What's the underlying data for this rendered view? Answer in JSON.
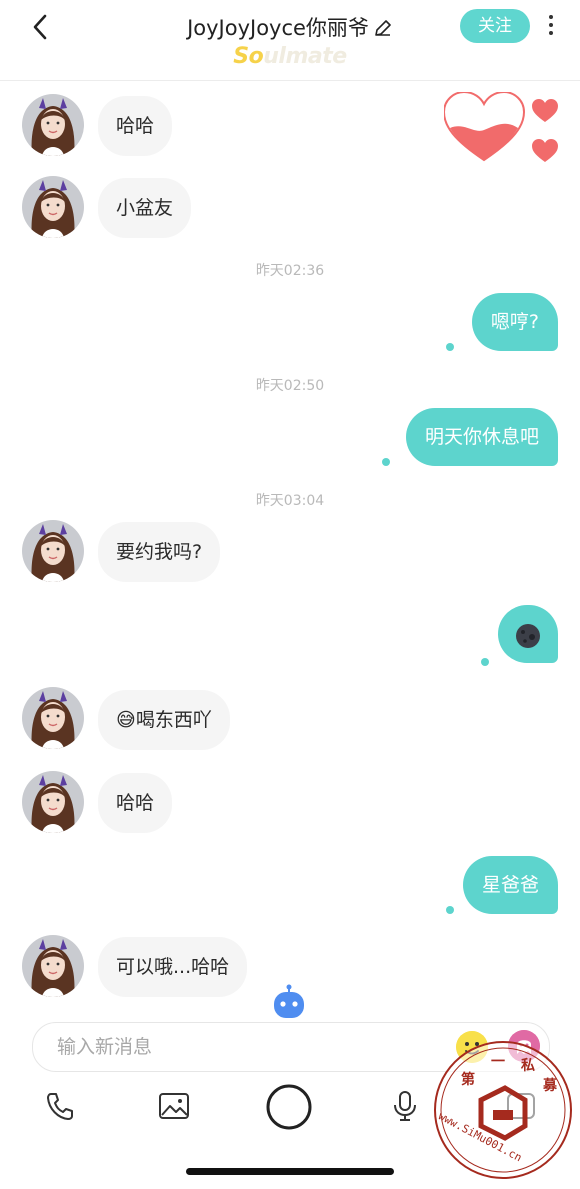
{
  "header": {
    "title": "JoyJoyJoyce你丽爷",
    "brand_prefix": "So",
    "brand_suffix": "ulmate",
    "follow_label": "关注"
  },
  "messages": {
    "m1": "哈哈",
    "m2": "小盆友",
    "t1": "昨天02:36",
    "m3": "嗯哼?",
    "t2": "昨天02:50",
    "m4": "明天你休息吧",
    "t3": "昨天03:04",
    "m5": "要约我吗?",
    "m6_icon": "new-moon-face-emoji",
    "m7_emoji": "😅",
    "m7_text": "喝东西吖",
    "m8": "哈哈",
    "m9": "星爸爸",
    "m10": "可以哦...哈哈"
  },
  "composer": {
    "placeholder": "输入新消息"
  },
  "toolbar": {
    "items": [
      "phone-icon",
      "image-icon",
      "camera-shutter-icon",
      "microphone-icon",
      "more-icon"
    ]
  },
  "watermark": {
    "chars": [
      "第",
      "一",
      "私",
      "募"
    ],
    "url": "www.SiMu001.cn"
  },
  "colors": {
    "accent": "#5dd4cd",
    "incoming_bubble": "#f5f5f5",
    "heart": "#f16b6b",
    "watermark": "#a52a1e"
  }
}
